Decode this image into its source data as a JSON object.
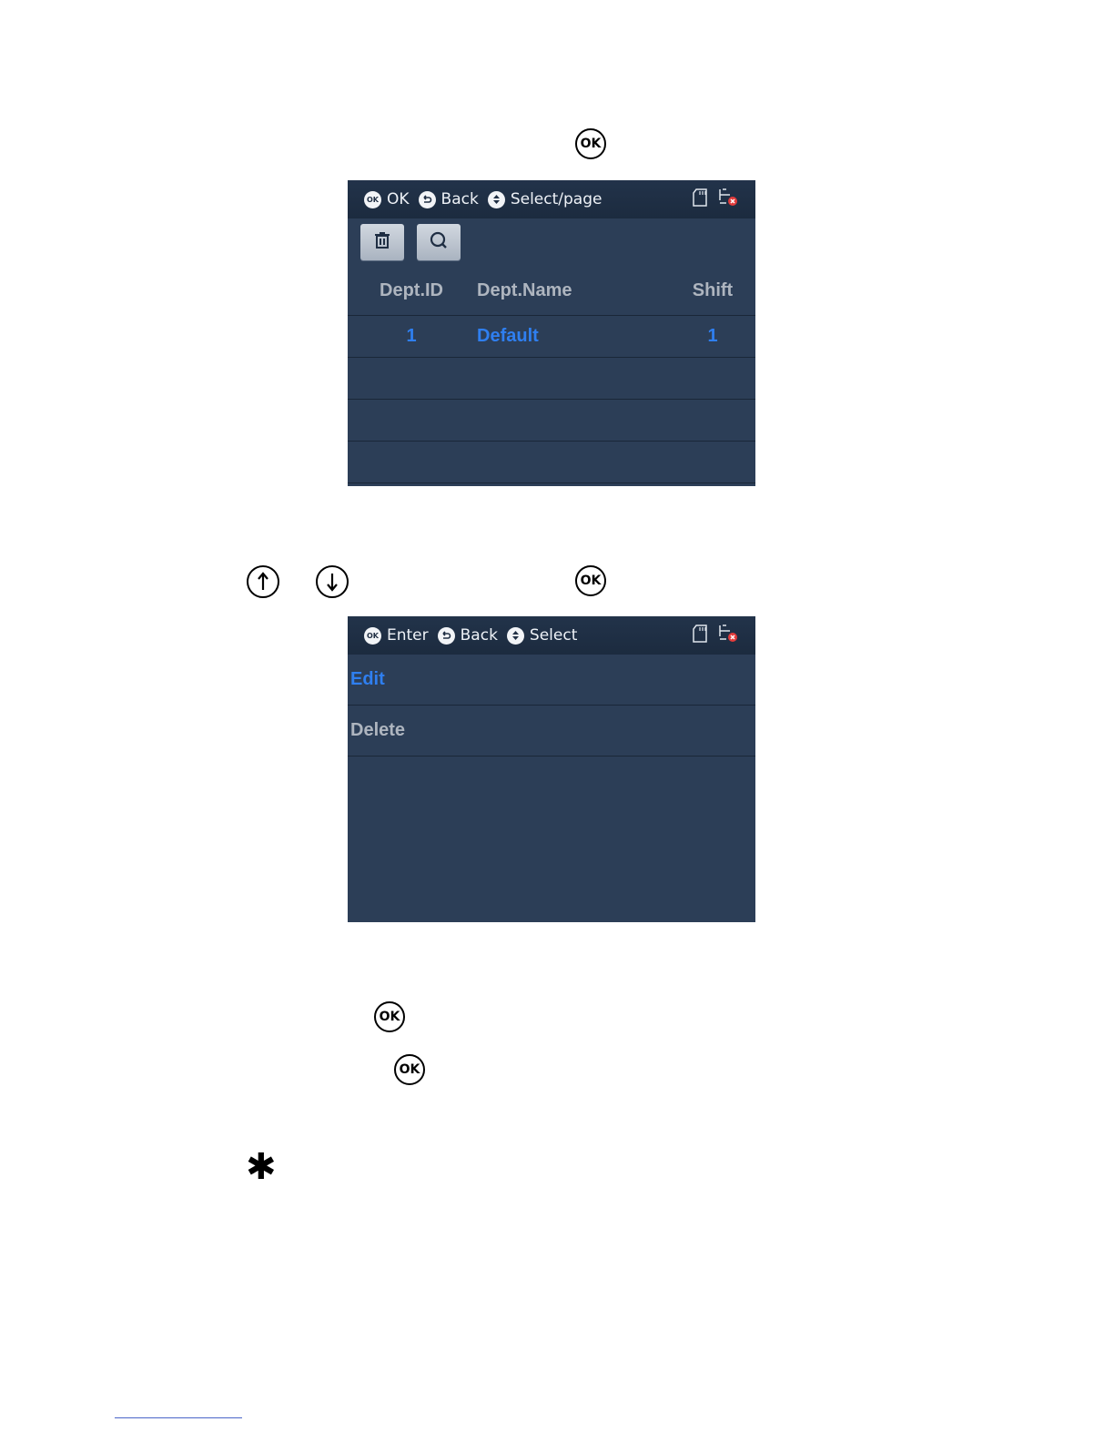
{
  "screen1": {
    "hints": [
      {
        "icon": "ok-key-icon",
        "key": "OK",
        "label": "OK"
      },
      {
        "icon": "back-key-icon",
        "key": "",
        "label": "Back"
      },
      {
        "icon": "updown-key-icon",
        "key": "",
        "label": "Select/page"
      }
    ],
    "table": {
      "headers": [
        "Dept.ID",
        "Dept.Name",
        "Shift"
      ],
      "rows": [
        {
          "id": "1",
          "name": "Default",
          "shift": "1"
        }
      ]
    }
  },
  "screen2": {
    "hints": [
      {
        "icon": "ok-key-icon",
        "key": "OK",
        "label": "Enter"
      },
      {
        "icon": "back-key-icon",
        "key": "",
        "label": "Back"
      },
      {
        "icon": "updown-key-icon",
        "key": "",
        "label": "Select"
      }
    ],
    "menu": [
      "Edit",
      "Delete"
    ]
  },
  "keys": {
    "ok_label": "OK"
  },
  "colors": {
    "screen_bg": "#2c3e57",
    "accent_blue": "#2f7ff0",
    "muted_text": "#aeb5bf"
  }
}
